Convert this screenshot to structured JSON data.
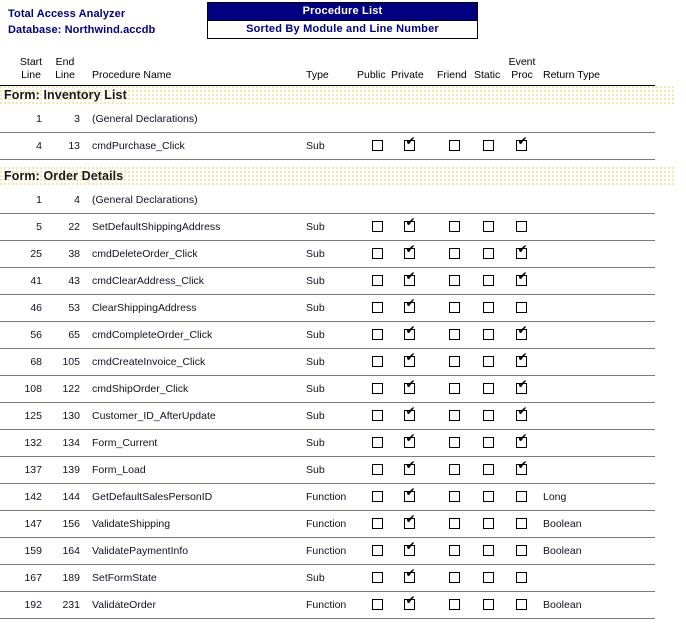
{
  "header": {
    "app_title": "Total Access Analyzer",
    "database_line": "Database: Northwind.accdb",
    "report_title": "Procedure List",
    "report_subtitle": "Sorted By Module and Line Number",
    "colors": {
      "title_bar_bg": "#000080",
      "title_text": "#FFFFFF",
      "subtitle_text": "#000080",
      "ident_text": "#000080",
      "band_dots": "#F2E6A8"
    }
  },
  "columns": {
    "start_line_1": "Start",
    "start_line_2": "Line",
    "end_line_1": "End",
    "end_line_2": "Line",
    "procedure_name": "Procedure Name",
    "type": "Type",
    "public": "Public",
    "private": "Private",
    "friend": "Friend",
    "static": "Static",
    "event_proc_1": "Event",
    "event_proc_2": "Proc",
    "return_type": "Return Type"
  },
  "sections": [
    {
      "label": "Form: Inventory List",
      "rows": [
        {
          "start": "1",
          "end": "3",
          "name": "(General Declarations)",
          "type": "",
          "public": false,
          "private": false,
          "friend": false,
          "static": false,
          "event": false,
          "show_checkboxes": false,
          "return_type": ""
        },
        {
          "start": "4",
          "end": "13",
          "name": "cmdPurchase_Click",
          "type": "Sub",
          "public": false,
          "private": true,
          "friend": false,
          "static": false,
          "event": true,
          "show_checkboxes": true,
          "return_type": ""
        }
      ]
    },
    {
      "label": "Form: Order Details",
      "rows": [
        {
          "start": "1",
          "end": "4",
          "name": "(General Declarations)",
          "type": "",
          "public": false,
          "private": false,
          "friend": false,
          "static": false,
          "event": false,
          "show_checkboxes": false,
          "return_type": ""
        },
        {
          "start": "5",
          "end": "22",
          "name": "SetDefaultShippingAddress",
          "type": "Sub",
          "public": false,
          "private": true,
          "friend": false,
          "static": false,
          "event": false,
          "show_checkboxes": true,
          "return_type": ""
        },
        {
          "start": "25",
          "end": "38",
          "name": "cmdDeleteOrder_Click",
          "type": "Sub",
          "public": false,
          "private": true,
          "friend": false,
          "static": false,
          "event": true,
          "show_checkboxes": true,
          "return_type": ""
        },
        {
          "start": "41",
          "end": "43",
          "name": "cmdClearAddress_Click",
          "type": "Sub",
          "public": false,
          "private": true,
          "friend": false,
          "static": false,
          "event": true,
          "show_checkboxes": true,
          "return_type": ""
        },
        {
          "start": "46",
          "end": "53",
          "name": "ClearShippingAddress",
          "type": "Sub",
          "public": false,
          "private": true,
          "friend": false,
          "static": false,
          "event": false,
          "show_checkboxes": true,
          "return_type": ""
        },
        {
          "start": "56",
          "end": "65",
          "name": "cmdCompleteOrder_Click",
          "type": "Sub",
          "public": false,
          "private": true,
          "friend": false,
          "static": false,
          "event": true,
          "show_checkboxes": true,
          "return_type": ""
        },
        {
          "start": "68",
          "end": "105",
          "name": "cmdCreateInvoice_Click",
          "type": "Sub",
          "public": false,
          "private": true,
          "friend": false,
          "static": false,
          "event": true,
          "show_checkboxes": true,
          "return_type": ""
        },
        {
          "start": "108",
          "end": "122",
          "name": "cmdShipOrder_Click",
          "type": "Sub",
          "public": false,
          "private": true,
          "friend": false,
          "static": false,
          "event": true,
          "show_checkboxes": true,
          "return_type": ""
        },
        {
          "start": "125",
          "end": "130",
          "name": "Customer_ID_AfterUpdate",
          "type": "Sub",
          "public": false,
          "private": true,
          "friend": false,
          "static": false,
          "event": true,
          "show_checkboxes": true,
          "return_type": ""
        },
        {
          "start": "132",
          "end": "134",
          "name": "Form_Current",
          "type": "Sub",
          "public": false,
          "private": true,
          "friend": false,
          "static": false,
          "event": true,
          "show_checkboxes": true,
          "return_type": ""
        },
        {
          "start": "137",
          "end": "139",
          "name": "Form_Load",
          "type": "Sub",
          "public": false,
          "private": true,
          "friend": false,
          "static": false,
          "event": true,
          "show_checkboxes": true,
          "return_type": ""
        },
        {
          "start": "142",
          "end": "144",
          "name": "GetDefaultSalesPersonID",
          "type": "Function",
          "public": false,
          "private": true,
          "friend": false,
          "static": false,
          "event": false,
          "show_checkboxes": true,
          "return_type": "Long"
        },
        {
          "start": "147",
          "end": "156",
          "name": "ValidateShipping",
          "type": "Function",
          "public": false,
          "private": true,
          "friend": false,
          "static": false,
          "event": false,
          "show_checkboxes": true,
          "return_type": "Boolean"
        },
        {
          "start": "159",
          "end": "164",
          "name": "ValidatePaymentInfo",
          "type": "Function",
          "public": false,
          "private": true,
          "friend": false,
          "static": false,
          "event": false,
          "show_checkboxes": true,
          "return_type": "Boolean"
        },
        {
          "start": "167",
          "end": "189",
          "name": "SetFormState",
          "type": "Sub",
          "public": false,
          "private": true,
          "friend": false,
          "static": false,
          "event": false,
          "show_checkboxes": true,
          "return_type": ""
        },
        {
          "start": "192",
          "end": "231",
          "name": "ValidateOrder",
          "type": "Function",
          "public": false,
          "private": true,
          "friend": false,
          "static": false,
          "event": false,
          "show_checkboxes": true,
          "return_type": "Boolean"
        }
      ]
    }
  ],
  "checkbox_glyph": "✔"
}
